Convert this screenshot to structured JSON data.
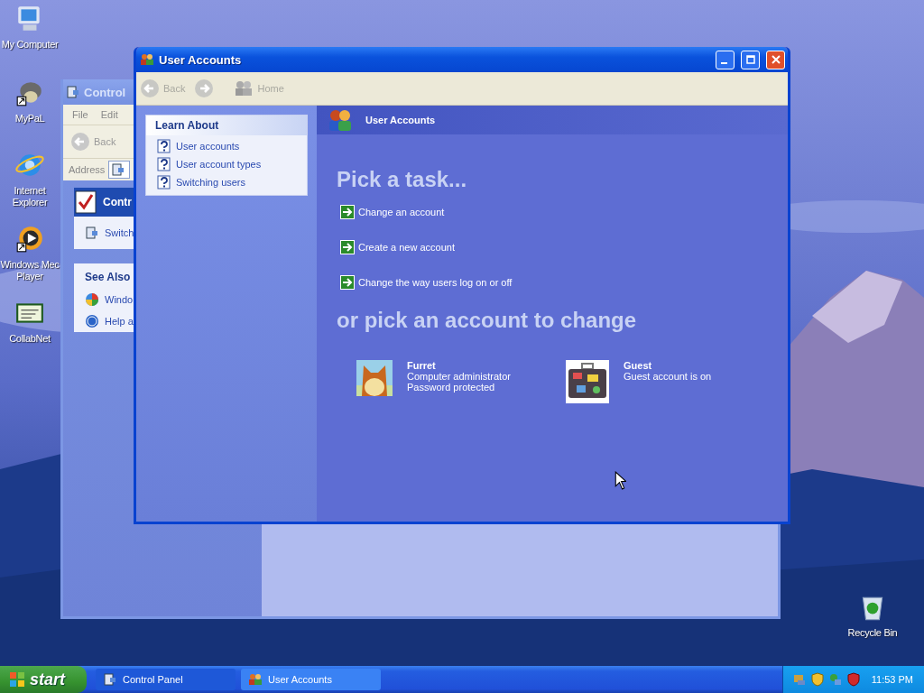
{
  "desktop": {
    "icons": [
      {
        "kind": "computer",
        "lines": [
          "My Computer"
        ]
      },
      {
        "kind": "pal",
        "lines": [
          "MyPaL"
        ]
      },
      {
        "kind": "browser",
        "lines": [
          "Internet",
          "Explorer"
        ]
      },
      {
        "kind": "media",
        "lines": [
          "Windows Mec",
          "Player"
        ]
      },
      {
        "kind": "certificate",
        "lines": [
          "CollabNet"
        ]
      },
      {
        "kind": "recycle",
        "lines": [
          "Recycle Bin"
        ]
      }
    ]
  },
  "control_panel_window": {
    "title": "Control",
    "menu": [
      "File",
      "Edit"
    ],
    "back": "Back",
    "address_label": "Address",
    "task_box": {
      "title": "Contr",
      "item": "Switch"
    },
    "see_also": {
      "title": "See Also",
      "items": [
        "Windo",
        "Help a"
      ]
    }
  },
  "user_accounts_window": {
    "title": "User Accounts",
    "toolbar": {
      "back": "Back",
      "home": "Home"
    },
    "learn_about": {
      "title": "Learn About",
      "items": [
        "User accounts",
        "User account types",
        "Switching users"
      ]
    },
    "header": "User Accounts",
    "task_heading": "Pick a task...",
    "tasks": [
      "Change an account",
      "Create a new account",
      "Change the way users log on or off"
    ],
    "account_heading": "or pick an account to change",
    "accounts": [
      {
        "name": "Furret",
        "kind": "animal",
        "details": [
          "Computer administrator",
          "Password protected"
        ]
      },
      {
        "name": "Guest",
        "kind": "suitcase",
        "details": [
          "Guest account is on"
        ]
      }
    ]
  },
  "taskbar": {
    "start": "start",
    "tasks": [
      {
        "label": "Control Panel",
        "selected": false
      },
      {
        "label": "User Accounts",
        "selected": true
      }
    ],
    "clock": "11:53 PM"
  }
}
